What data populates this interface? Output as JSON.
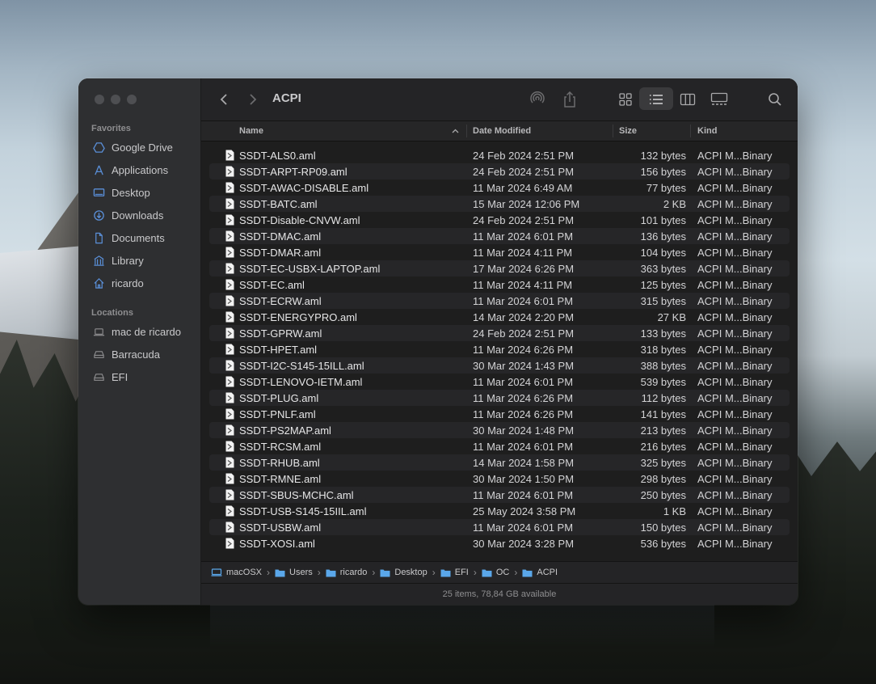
{
  "window": {
    "title": "ACPI"
  },
  "sidebar": {
    "favorites_label": "Favorites",
    "favorites": [
      {
        "label": "Google Drive",
        "icon": "google-drive-icon"
      },
      {
        "label": "Applications",
        "icon": "applications-icon"
      },
      {
        "label": "Desktop",
        "icon": "desktop-icon"
      },
      {
        "label": "Downloads",
        "icon": "downloads-icon"
      },
      {
        "label": "Documents",
        "icon": "documents-icon"
      },
      {
        "label": "Library",
        "icon": "library-icon"
      },
      {
        "label": "ricardo",
        "icon": "home-icon"
      }
    ],
    "locations_label": "Locations",
    "locations": [
      {
        "label": "mac de ricardo",
        "icon": "laptop-icon"
      },
      {
        "label": "Barracuda",
        "icon": "drive-icon"
      },
      {
        "label": "EFI",
        "icon": "drive-icon"
      }
    ]
  },
  "columns": {
    "name": "Name",
    "date": "Date Modified",
    "size": "Size",
    "kind": "Kind"
  },
  "files": [
    {
      "name": "SSDT-ALS0.aml",
      "date": "24 Feb 2024 2:51 PM",
      "size": "132 bytes",
      "kind": "ACPI M...Binary"
    },
    {
      "name": "SSDT-ARPT-RP09.aml",
      "date": "24 Feb 2024 2:51 PM",
      "size": "156 bytes",
      "kind": "ACPI M...Binary"
    },
    {
      "name": "SSDT-AWAC-DISABLE.aml",
      "date": "11 Mar 2024 6:49 AM",
      "size": "77 bytes",
      "kind": "ACPI M...Binary"
    },
    {
      "name": "SSDT-BATC.aml",
      "date": "15 Mar 2024 12:06 PM",
      "size": "2 KB",
      "kind": "ACPI M...Binary"
    },
    {
      "name": "SSDT-Disable-CNVW.aml",
      "date": "24 Feb 2024 2:51 PM",
      "size": "101 bytes",
      "kind": "ACPI M...Binary"
    },
    {
      "name": "SSDT-DMAC.aml",
      "date": "11 Mar 2024 6:01 PM",
      "size": "136 bytes",
      "kind": "ACPI M...Binary"
    },
    {
      "name": "SSDT-DMAR.aml",
      "date": "11 Mar 2024 4:11 PM",
      "size": "104 bytes",
      "kind": "ACPI M...Binary"
    },
    {
      "name": "SSDT-EC-USBX-LAPTOP.aml",
      "date": "17 Mar 2024 6:26 PM",
      "size": "363 bytes",
      "kind": "ACPI M...Binary"
    },
    {
      "name": "SSDT-EC.aml",
      "date": "11 Mar 2024 4:11 PM",
      "size": "125 bytes",
      "kind": "ACPI M...Binary"
    },
    {
      "name": "SSDT-ECRW.aml",
      "date": "11 Mar 2024 6:01 PM",
      "size": "315 bytes",
      "kind": "ACPI M...Binary"
    },
    {
      "name": "SSDT-ENERGYPRO.aml",
      "date": "14 Mar 2024 2:20 PM",
      "size": "27 KB",
      "kind": "ACPI M...Binary"
    },
    {
      "name": "SSDT-GPRW.aml",
      "date": "24 Feb 2024 2:51 PM",
      "size": "133 bytes",
      "kind": "ACPI M...Binary"
    },
    {
      "name": "SSDT-HPET.aml",
      "date": "11 Mar 2024 6:26 PM",
      "size": "318 bytes",
      "kind": "ACPI M...Binary"
    },
    {
      "name": "SSDT-I2C-S145-15ILL.aml",
      "date": "30 Mar 2024 1:43 PM",
      "size": "388 bytes",
      "kind": "ACPI M...Binary"
    },
    {
      "name": "SSDT-LENOVO-IETM.aml",
      "date": "11 Mar 2024 6:01 PM",
      "size": "539 bytes",
      "kind": "ACPI M...Binary"
    },
    {
      "name": "SSDT-PLUG.aml",
      "date": "11 Mar 2024 6:26 PM",
      "size": "112 bytes",
      "kind": "ACPI M...Binary"
    },
    {
      "name": "SSDT-PNLF.aml",
      "date": "11 Mar 2024 6:26 PM",
      "size": "141 bytes",
      "kind": "ACPI M...Binary"
    },
    {
      "name": "SSDT-PS2MAP.aml",
      "date": "30 Mar 2024 1:48 PM",
      "size": "213 bytes",
      "kind": "ACPI M...Binary"
    },
    {
      "name": "SSDT-RCSM.aml",
      "date": "11 Mar 2024 6:01 PM",
      "size": "216 bytes",
      "kind": "ACPI M...Binary"
    },
    {
      "name": "SSDT-RHUB.aml",
      "date": "14 Mar 2024 1:58 PM",
      "size": "325 bytes",
      "kind": "ACPI M...Binary"
    },
    {
      "name": "SSDT-RMNE.aml",
      "date": "30 Mar 2024 1:50 PM",
      "size": "298 bytes",
      "kind": "ACPI M...Binary"
    },
    {
      "name": "SSDT-SBUS-MCHC.aml",
      "date": "11 Mar 2024 6:01 PM",
      "size": "250 bytes",
      "kind": "ACPI M...Binary"
    },
    {
      "name": "SSDT-USB-S145-15IIL.aml",
      "date": "25 May 2024 3:58 PM",
      "size": "1 KB",
      "kind": "ACPI M...Binary"
    },
    {
      "name": "SSDT-USBW.aml",
      "date": "11 Mar 2024 6:01 PM",
      "size": "150 bytes",
      "kind": "ACPI M...Binary"
    },
    {
      "name": "SSDT-XOSI.aml",
      "date": "30 Mar 2024 3:28 PM",
      "size": "536 bytes",
      "kind": "ACPI M...Binary"
    }
  ],
  "path": [
    "macOSX",
    "Users",
    "ricardo",
    "Desktop",
    "EFI",
    "OC",
    "ACPI"
  ],
  "status": "25 items, 78,84 GB available",
  "colors": {
    "accent": "#3b82f6",
    "sidebar_icon": "#5a8fd8",
    "folder": "#5aa7ea"
  }
}
